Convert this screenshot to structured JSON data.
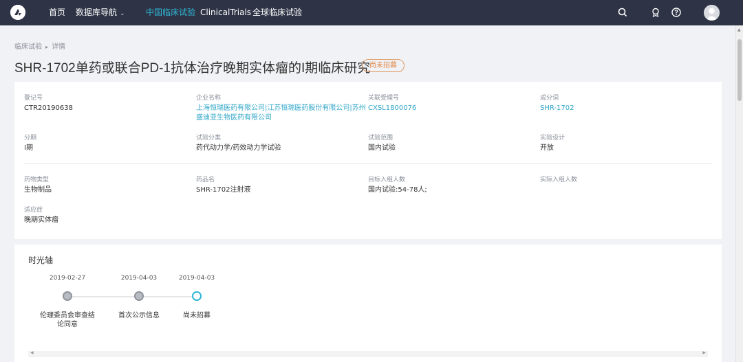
{
  "nav": {
    "items": [
      "首页",
      "数据库导航",
      "中国临床试验",
      "ClinicalTrials",
      "全球临床试验"
    ],
    "active_index": 2
  },
  "breadcrumb": {
    "root": "临床试验",
    "current": "详情"
  },
  "page": {
    "title": "SHR-1702单药或联合PD-1抗体治疗晚期实体瘤的I期临床研究",
    "status": "尚未招募"
  },
  "info": {
    "fields": [
      {
        "label": "登记号",
        "value": "CTR20190638"
      },
      {
        "label": "企业名称",
        "value": "上海恒瑞医药有限公司|江苏恒瑞医药股份有限公司|苏州盛迪亚生物医药有限公司"
      },
      {
        "label": "关联受理号",
        "value": "CXSL1800076"
      },
      {
        "label": "成分词",
        "value": "SHR-1702"
      },
      {
        "label": "分期",
        "value": "I期"
      },
      {
        "label": "试验分类",
        "value": "药代动力学/药效动力学试验"
      },
      {
        "label": "试验范围",
        "value": "国内试验"
      },
      {
        "label": "实验设计",
        "value": "开放"
      },
      {
        "label": "药物类型",
        "value": "生物制品"
      },
      {
        "label": "药品名",
        "value": "SHR-1702注射液"
      },
      {
        "label": "目标入组人数",
        "value": "国内试验:54-78人;"
      },
      {
        "label": "实际入组人数",
        "value": ""
      },
      {
        "label": "适应症",
        "value": "晚期实体瘤"
      }
    ]
  },
  "timeline": {
    "title": "时光轴",
    "events": [
      {
        "date": "2019-02-27",
        "label": "伦理委员会审查结论同意"
      },
      {
        "date": "2019-04-03",
        "label": "首次公示信息"
      },
      {
        "date": "2019-04-03",
        "label": "尚未招募"
      }
    ]
  },
  "colors": {
    "nav_bg": "#2e3446",
    "accent": "#2fb6d6",
    "status_badge": "#e0884a"
  },
  "icons": [
    "logo-icon",
    "chevron-down-icon",
    "search-icon",
    "award-icon",
    "help-icon",
    "avatar-icon"
  ]
}
